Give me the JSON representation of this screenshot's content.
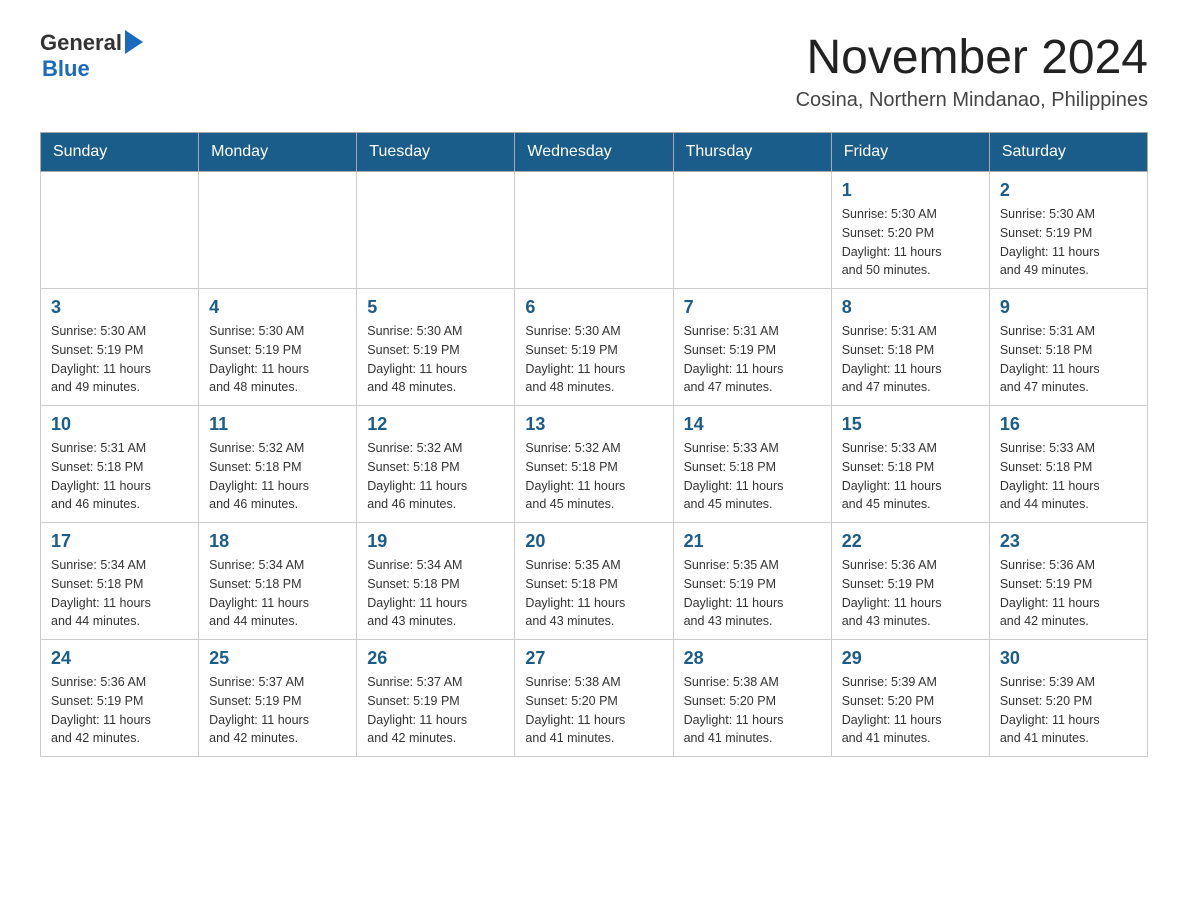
{
  "header": {
    "logo": {
      "general": "General",
      "blue": "Blue",
      "arrow": "▶"
    },
    "title": "November 2024",
    "subtitle": "Cosina, Northern Mindanao, Philippines"
  },
  "calendar": {
    "days_of_week": [
      "Sunday",
      "Monday",
      "Tuesday",
      "Wednesday",
      "Thursday",
      "Friday",
      "Saturday"
    ],
    "weeks": [
      [
        {
          "day": "",
          "info": ""
        },
        {
          "day": "",
          "info": ""
        },
        {
          "day": "",
          "info": ""
        },
        {
          "day": "",
          "info": ""
        },
        {
          "day": "",
          "info": ""
        },
        {
          "day": "1",
          "info": "Sunrise: 5:30 AM\nSunset: 5:20 PM\nDaylight: 11 hours\nand 50 minutes."
        },
        {
          "day": "2",
          "info": "Sunrise: 5:30 AM\nSunset: 5:19 PM\nDaylight: 11 hours\nand 49 minutes."
        }
      ],
      [
        {
          "day": "3",
          "info": "Sunrise: 5:30 AM\nSunset: 5:19 PM\nDaylight: 11 hours\nand 49 minutes."
        },
        {
          "day": "4",
          "info": "Sunrise: 5:30 AM\nSunset: 5:19 PM\nDaylight: 11 hours\nand 48 minutes."
        },
        {
          "day": "5",
          "info": "Sunrise: 5:30 AM\nSunset: 5:19 PM\nDaylight: 11 hours\nand 48 minutes."
        },
        {
          "day": "6",
          "info": "Sunrise: 5:30 AM\nSunset: 5:19 PM\nDaylight: 11 hours\nand 48 minutes."
        },
        {
          "day": "7",
          "info": "Sunrise: 5:31 AM\nSunset: 5:19 PM\nDaylight: 11 hours\nand 47 minutes."
        },
        {
          "day": "8",
          "info": "Sunrise: 5:31 AM\nSunset: 5:18 PM\nDaylight: 11 hours\nand 47 minutes."
        },
        {
          "day": "9",
          "info": "Sunrise: 5:31 AM\nSunset: 5:18 PM\nDaylight: 11 hours\nand 47 minutes."
        }
      ],
      [
        {
          "day": "10",
          "info": "Sunrise: 5:31 AM\nSunset: 5:18 PM\nDaylight: 11 hours\nand 46 minutes."
        },
        {
          "day": "11",
          "info": "Sunrise: 5:32 AM\nSunset: 5:18 PM\nDaylight: 11 hours\nand 46 minutes."
        },
        {
          "day": "12",
          "info": "Sunrise: 5:32 AM\nSunset: 5:18 PM\nDaylight: 11 hours\nand 46 minutes."
        },
        {
          "day": "13",
          "info": "Sunrise: 5:32 AM\nSunset: 5:18 PM\nDaylight: 11 hours\nand 45 minutes."
        },
        {
          "day": "14",
          "info": "Sunrise: 5:33 AM\nSunset: 5:18 PM\nDaylight: 11 hours\nand 45 minutes."
        },
        {
          "day": "15",
          "info": "Sunrise: 5:33 AM\nSunset: 5:18 PM\nDaylight: 11 hours\nand 45 minutes."
        },
        {
          "day": "16",
          "info": "Sunrise: 5:33 AM\nSunset: 5:18 PM\nDaylight: 11 hours\nand 44 minutes."
        }
      ],
      [
        {
          "day": "17",
          "info": "Sunrise: 5:34 AM\nSunset: 5:18 PM\nDaylight: 11 hours\nand 44 minutes."
        },
        {
          "day": "18",
          "info": "Sunrise: 5:34 AM\nSunset: 5:18 PM\nDaylight: 11 hours\nand 44 minutes."
        },
        {
          "day": "19",
          "info": "Sunrise: 5:34 AM\nSunset: 5:18 PM\nDaylight: 11 hours\nand 43 minutes."
        },
        {
          "day": "20",
          "info": "Sunrise: 5:35 AM\nSunset: 5:18 PM\nDaylight: 11 hours\nand 43 minutes."
        },
        {
          "day": "21",
          "info": "Sunrise: 5:35 AM\nSunset: 5:19 PM\nDaylight: 11 hours\nand 43 minutes."
        },
        {
          "day": "22",
          "info": "Sunrise: 5:36 AM\nSunset: 5:19 PM\nDaylight: 11 hours\nand 43 minutes."
        },
        {
          "day": "23",
          "info": "Sunrise: 5:36 AM\nSunset: 5:19 PM\nDaylight: 11 hours\nand 42 minutes."
        }
      ],
      [
        {
          "day": "24",
          "info": "Sunrise: 5:36 AM\nSunset: 5:19 PM\nDaylight: 11 hours\nand 42 minutes."
        },
        {
          "day": "25",
          "info": "Sunrise: 5:37 AM\nSunset: 5:19 PM\nDaylight: 11 hours\nand 42 minutes."
        },
        {
          "day": "26",
          "info": "Sunrise: 5:37 AM\nSunset: 5:19 PM\nDaylight: 11 hours\nand 42 minutes."
        },
        {
          "day": "27",
          "info": "Sunrise: 5:38 AM\nSunset: 5:20 PM\nDaylight: 11 hours\nand 41 minutes."
        },
        {
          "day": "28",
          "info": "Sunrise: 5:38 AM\nSunset: 5:20 PM\nDaylight: 11 hours\nand 41 minutes."
        },
        {
          "day": "29",
          "info": "Sunrise: 5:39 AM\nSunset: 5:20 PM\nDaylight: 11 hours\nand 41 minutes."
        },
        {
          "day": "30",
          "info": "Sunrise: 5:39 AM\nSunset: 5:20 PM\nDaylight: 11 hours\nand 41 minutes."
        }
      ]
    ]
  }
}
